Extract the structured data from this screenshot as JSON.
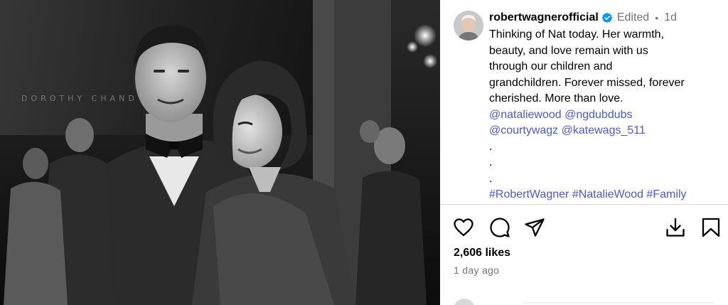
{
  "post": {
    "username": "robertwagnerofficial",
    "edited": "Edited",
    "separator": "•",
    "age": "1d",
    "caption_lines": [
      "Thinking of Nat today. Her warmth,",
      "beauty, and love remain with us",
      "through our children and",
      "grandchildren. Forever missed, forever",
      "cherished. More than love."
    ],
    "mentions": [
      "@nataliewood",
      "@ngdubdubs",
      "@courtywagz",
      "@katewags_511"
    ],
    "dots": [
      ".",
      ".",
      "."
    ],
    "hashtags": [
      "#RobertWagner",
      "#NatalieWood",
      "#Family"
    ],
    "likes": "2,606 likes",
    "time_ago": "1 day ago"
  },
  "photo": {
    "background_sign_text": "DOROTHY CHAND"
  },
  "icons": {
    "like": "heart-icon",
    "comment": "comment-icon",
    "share": "share-icon",
    "download": "download-icon",
    "save": "bookmark-icon",
    "verified": "verified-badge-icon"
  },
  "colors": {
    "link": "#4a5ad8",
    "verified": "#0095f6",
    "meta": "#737373",
    "divider": "#dbdbdb"
  }
}
